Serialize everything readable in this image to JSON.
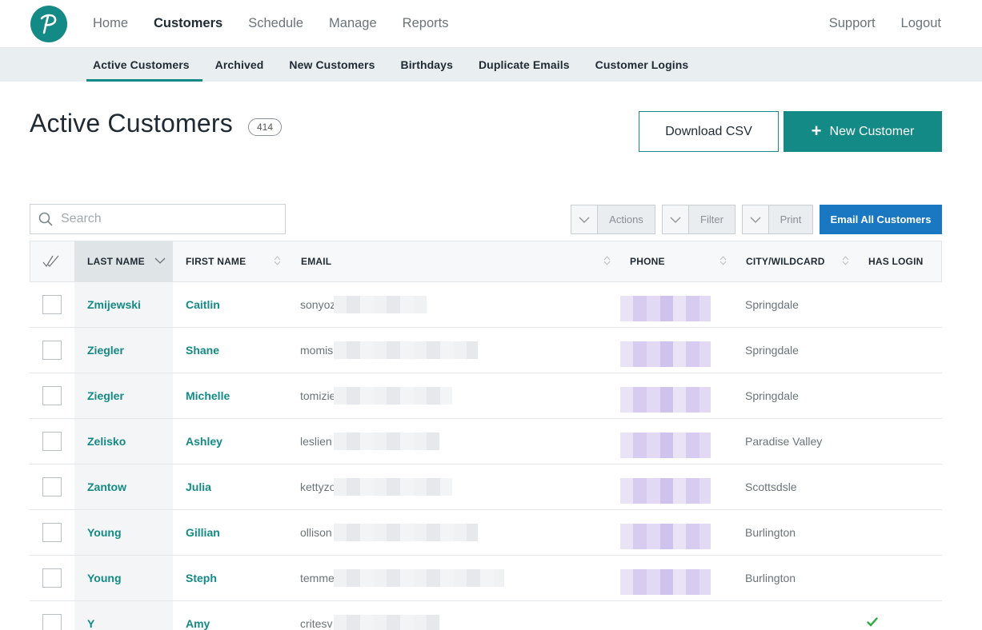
{
  "nav": {
    "left": [
      "Home",
      "Customers",
      "Schedule",
      "Manage",
      "Reports"
    ],
    "active_index": 1,
    "right": [
      "Support",
      "Logout"
    ]
  },
  "subnav": {
    "items": [
      "Active Customers",
      "Archived",
      "New Customers",
      "Birthdays",
      "Duplicate Emails",
      "Customer Logins"
    ],
    "active_index": 0
  },
  "page": {
    "title": "Active Customers",
    "count": "414",
    "download_label": "Download CSV",
    "new_label": "New Customer"
  },
  "toolbar": {
    "search_placeholder": "Search",
    "actions_label": "Actions",
    "filter_label": "Filter",
    "print_label": "Print",
    "email_all_label": "Email All Customers"
  },
  "table": {
    "columns": [
      "LAST NAME",
      "FIRST NAME",
      "EMAIL",
      "PHONE",
      "CITY/WILDCARD",
      "HAS LOGIN"
    ],
    "sorted_column": "LAST NAME",
    "rows": [
      {
        "last": "Zmijewski",
        "first": "Caitlin",
        "email": "sonyoz",
        "city": "Springdale",
        "has_login": false
      },
      {
        "last": "Ziegler",
        "first": "Shane",
        "email": "momis",
        "city": "Springdale",
        "has_login": false
      },
      {
        "last": "Ziegler",
        "first": "Michelle",
        "email": "tomizie",
        "city": "Springdale",
        "has_login": false
      },
      {
        "last": "Zelisko",
        "first": "Ashley",
        "email": "leslien",
        "city": "Paradise Valley",
        "has_login": false
      },
      {
        "last": "Zantow",
        "first": "Julia",
        "email": "kettyzo",
        "city": "Scottsdsle",
        "has_login": false
      },
      {
        "last": "Young",
        "first": "Gillian",
        "email": "ollison",
        "city": "Burlington",
        "has_login": false
      },
      {
        "last": "Young",
        "first": "Steph",
        "email": "temme",
        "city": "Burlington",
        "has_login": false
      },
      {
        "last": "Y",
        "first": "Amy",
        "email": "critesv",
        "city": "",
        "has_login": true
      }
    ]
  },
  "colors": {
    "brand": "#138a85",
    "email_button": "#1a78c2",
    "check": "#2eaa3f"
  }
}
